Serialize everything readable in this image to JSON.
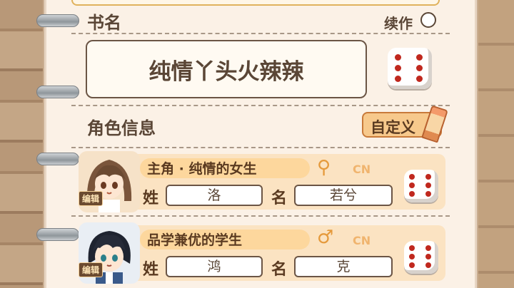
{
  "book": {
    "label": "书名",
    "sequel_label": "续作",
    "sequel_checked": false,
    "title": "纯情丫头火辣辣"
  },
  "roles": {
    "label": "角色信息",
    "custom_button": "自定义"
  },
  "characters": [
    {
      "title": "主角 · 纯情的女生",
      "gender_icon": "female-icon",
      "lang": "CN",
      "edit_label": "编辑",
      "surname_label": "姓",
      "surname": "洛",
      "name_label": "名",
      "given_name": "若兮"
    },
    {
      "title": "品学兼优的学生",
      "gender_icon": "male-icon",
      "lang": "CN",
      "edit_label": "编辑",
      "surname_label": "姓",
      "surname": "鸿",
      "name_label": "名",
      "given_name": "克"
    }
  ],
  "colors": {
    "accent": "#f7c98c",
    "dice_pip": "#c0281e",
    "text": "#5a4636"
  }
}
